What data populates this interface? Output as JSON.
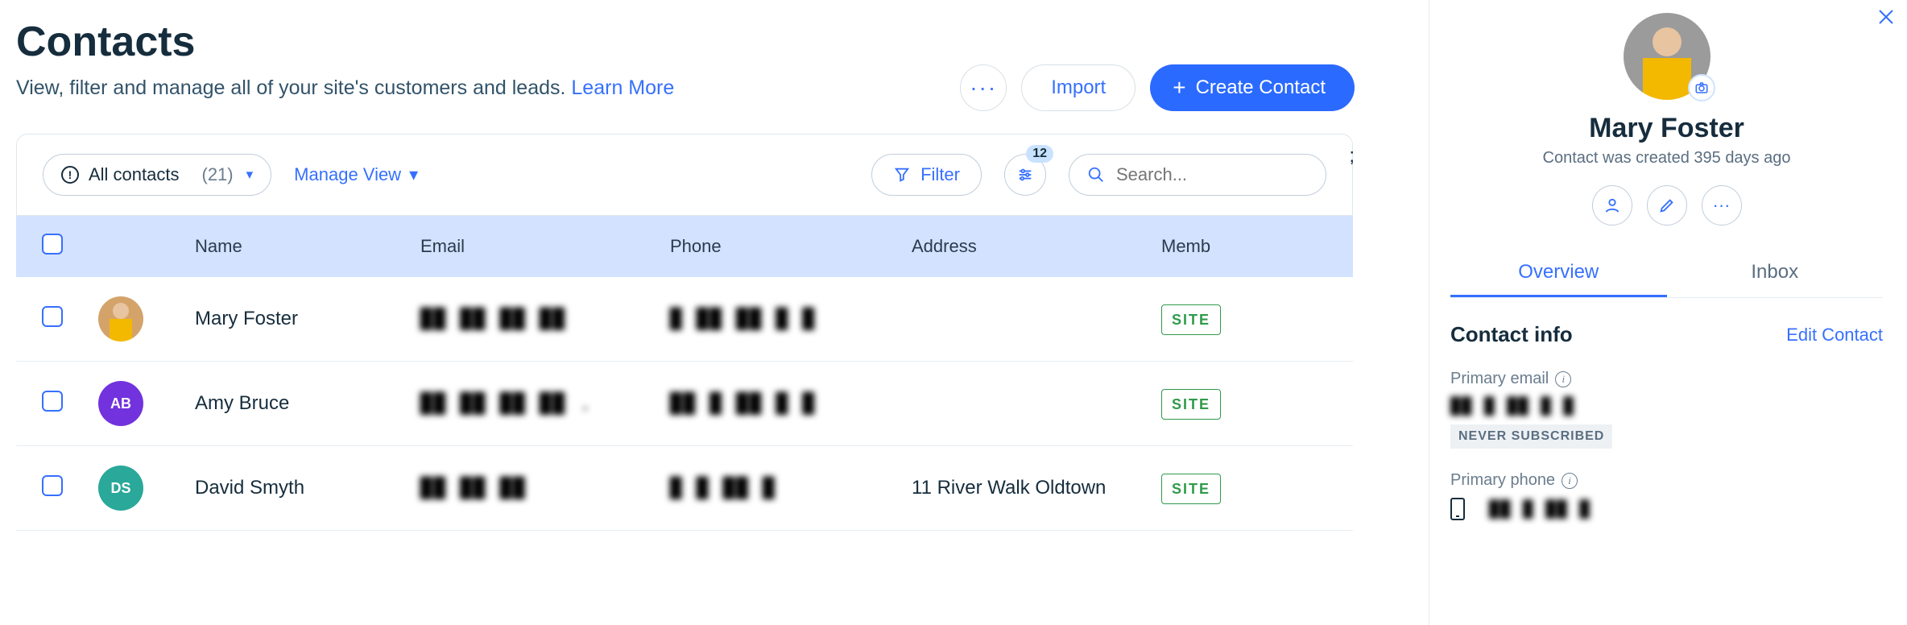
{
  "header": {
    "title": "Contacts",
    "subtitle_prefix": "View, filter and manage all of your site's customers and leads. ",
    "learn_more": "Learn More",
    "more_menu": "···",
    "import_label": "Import",
    "create_label": "Create Contact"
  },
  "toolbar": {
    "view_name": "All contacts",
    "count_display": "(21)",
    "manage_view": "Manage View",
    "filter": "Filter",
    "settings_badge": "12",
    "search_placeholder": "Search..."
  },
  "columns": {
    "name": "Name",
    "email": "Email",
    "phone": "Phone",
    "address": "Address",
    "member": "Memb"
  },
  "rows": [
    {
      "name": "Mary Foster",
      "avatar": "photo",
      "initials": "",
      "email": "██ ██ ██ ██",
      "phone": "█ ██ ██  █  █",
      "address": "",
      "badge": "SITE"
    },
    {
      "name": "Amy Bruce",
      "avatar": "ab",
      "initials": "AB",
      "email": "██ ██ ██ ██ .",
      "phone": "██ █ ██  █  █",
      "address": "",
      "badge": "SITE"
    },
    {
      "name": "David Smyth",
      "avatar": "ds",
      "initials": "DS",
      "email": "██  ██  ██",
      "phone": "█ █  ██  █",
      "address": "11 River Walk Oldtown",
      "badge": "SITE"
    }
  ],
  "side": {
    "name": "Mary Foster",
    "created": "Contact was created 395 days ago",
    "tabs": {
      "overview": "Overview",
      "inbox": "Inbox"
    },
    "section_title": "Contact info",
    "edit": "Edit Contact",
    "primary_email_label": "Primary email",
    "primary_email_value": "██ █ ██  █  █",
    "never_subscribed": "NEVER SUBSCRIBED",
    "primary_phone_label": "Primary phone",
    "primary_phone_value": "██ █ ██ █"
  }
}
